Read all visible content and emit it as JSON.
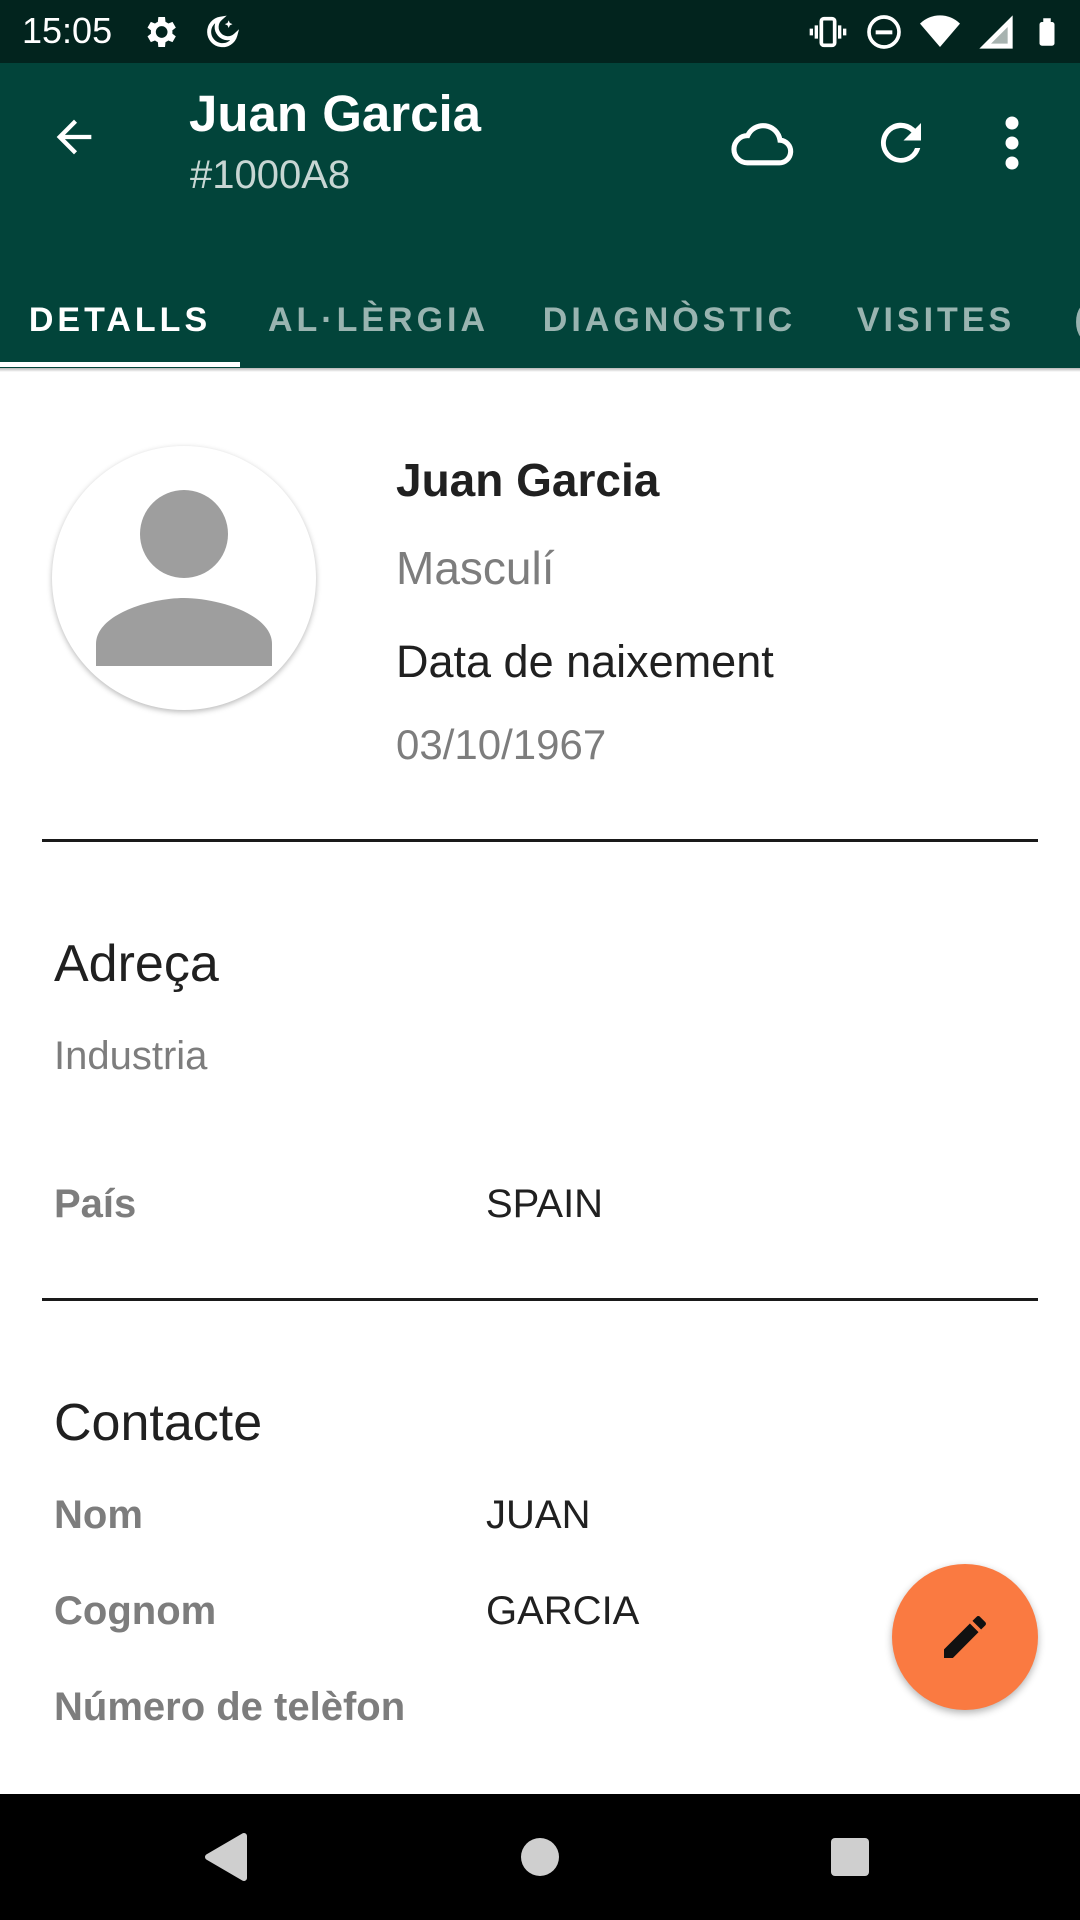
{
  "status_bar": {
    "time": "15:05",
    "left_icons": [
      "settings-icon",
      "do-not-disturb-moon-icon"
    ],
    "right_icons": [
      "vibrate-icon",
      "dnd-icon",
      "wifi-icon",
      "signal-icon",
      "battery-icon"
    ]
  },
  "app_bar": {
    "title": "Juan Garcia",
    "subtitle": "#1000A8",
    "actions": [
      "cloud-icon",
      "refresh-icon",
      "more-vert-icon"
    ],
    "background": "#02443a"
  },
  "tabs": [
    {
      "label": "DETALLS",
      "active": true
    },
    {
      "label": "AL·LÈRGIA",
      "active": false
    },
    {
      "label": "DIAGNÒSTIC",
      "active": false
    },
    {
      "label": "VISITES",
      "active": false
    }
  ],
  "patient": {
    "name": "Juan Garcia",
    "gender": "Masculí",
    "dob_label": "Data de naixement",
    "dob": "03/10/1967"
  },
  "address": {
    "title": "Adreça",
    "street": "Industria",
    "country_label": "País",
    "country_value": "SPAIN"
  },
  "contact": {
    "title": "Contacte",
    "first_name_label": "Nom",
    "first_name_value": "JUAN",
    "last_name_label": "Cognom",
    "last_name_value": "GARCIA",
    "phone_label": "Número de telèfon"
  },
  "fab": {
    "icon": "edit-pencil-icon",
    "color": "#fa7a41"
  },
  "nav_bar": {
    "buttons": [
      "back-triangle-icon",
      "home-circle-icon",
      "recents-square-icon"
    ]
  }
}
